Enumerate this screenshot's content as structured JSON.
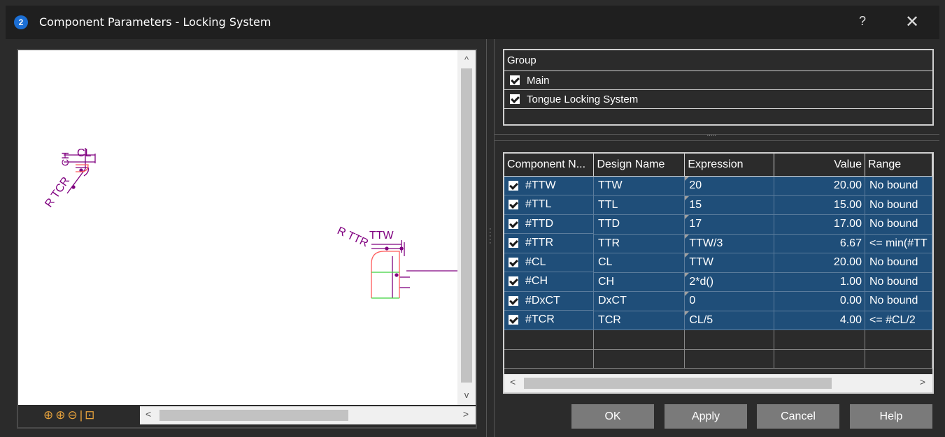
{
  "window": {
    "title": "Component Parameters - Locking System",
    "app_icon_glyph": "2",
    "help_glyph": "?",
    "close_glyph": "✕"
  },
  "preview": {
    "scroll_up": "^",
    "scroll_down": "v",
    "scroll_left": "<",
    "scroll_right": ">",
    "zoom_tools": "⊕⊕⊖|⊡",
    "labels": {
      "cl": "CL",
      "ch": "CH",
      "tcr": "R TCR",
      "ttw": "TTW",
      "ttr": "R TTR"
    }
  },
  "group": {
    "header": "Group",
    "rows": [
      {
        "label": "Main",
        "checked": true
      },
      {
        "label": "Tongue Locking System",
        "checked": true
      }
    ]
  },
  "components": {
    "columns": [
      "Component N...",
      "Design Name",
      "Expression",
      "Value",
      "Range"
    ],
    "rows": [
      {
        "name": "#TTW",
        "design": "TTW",
        "expr": "20",
        "value": "20.00",
        "range": "No bound"
      },
      {
        "name": "#TTL",
        "design": "TTL",
        "expr": "15",
        "value": "15.00",
        "range": "No bound"
      },
      {
        "name": "#TTD",
        "design": "TTD",
        "expr": "17",
        "value": "17.00",
        "range": "No bound"
      },
      {
        "name": "#TTR",
        "design": "TTR",
        "expr": "TTW/3",
        "value": "6.67",
        "range": "<= min(#TT"
      },
      {
        "name": "#CL",
        "design": "CL",
        "expr": "TTW",
        "value": "20.00",
        "range": "No bound"
      },
      {
        "name": "#CH",
        "design": "CH",
        "expr": "2*d()",
        "value": "1.00",
        "range": "No bound"
      },
      {
        "name": "#DxCT",
        "design": "DxCT",
        "expr": "0",
        "value": "0.00",
        "range": "No bound"
      },
      {
        "name": "#TCR",
        "design": "TCR",
        "expr": "CL/5",
        "value": "4.00",
        "range": "<= #CL/2"
      }
    ],
    "scroll_left": "<",
    "scroll_right": ">"
  },
  "buttons": {
    "ok": "OK",
    "apply": "Apply",
    "cancel": "Cancel",
    "help": "Help"
  },
  "colors": {
    "selection": "#1f4e79",
    "accent_icon": "#1c6fd4",
    "dimension": "#800080",
    "profile_red": "#ff5a5a",
    "profile_green": "#3cd23c"
  }
}
